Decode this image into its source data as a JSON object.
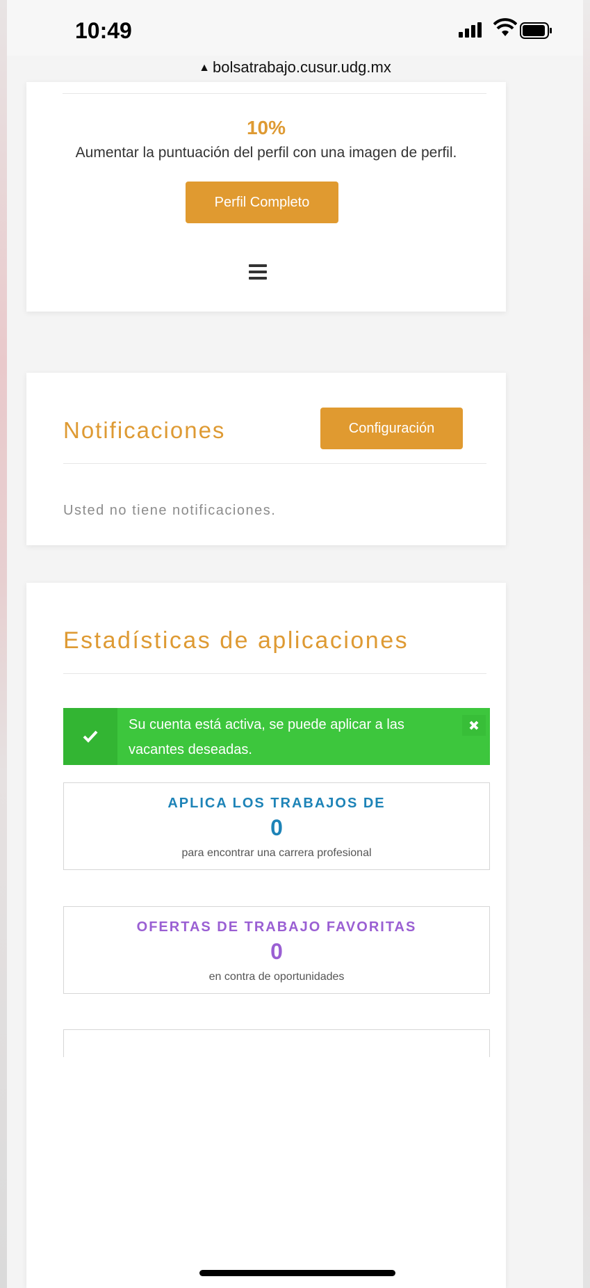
{
  "status_bar": {
    "time": "10:49",
    "url": "bolsatrabajo.cusur.udg.mx"
  },
  "profile": {
    "percent": "10%",
    "hint": "Aumentar la puntuación del perfil con una imagen de perfil.",
    "button_label": "Perfil Completo",
    "progress_fraction": 0.1
  },
  "notifications": {
    "title": "Notificaciones",
    "config_button_label": "Configuración",
    "empty_text": "Usted no tiene notificaciones."
  },
  "stats": {
    "title": "Estadísticas de aplicaciones",
    "alert_text": "Su cuenta está activa, se puede aplicar a las vacantes deseadas.",
    "boxes": [
      {
        "label": "APLICA LOS TRABAJOS DE",
        "count": "0",
        "description": "para encontrar una carrera profesional",
        "color": "#1d83b7"
      },
      {
        "label": "OFERTAS DE TRABAJO FAVORITAS",
        "count": "0",
        "description": "en contra de oportunidades",
        "color": "#9a5fd3"
      }
    ]
  },
  "colors": {
    "accent": "#e09a30",
    "success": "#3dc63d"
  },
  "icons": [
    "lock-icon",
    "signal-icon",
    "wifi-icon",
    "battery-icon",
    "hamburger-menu-icon",
    "check-icon",
    "close-icon"
  ]
}
